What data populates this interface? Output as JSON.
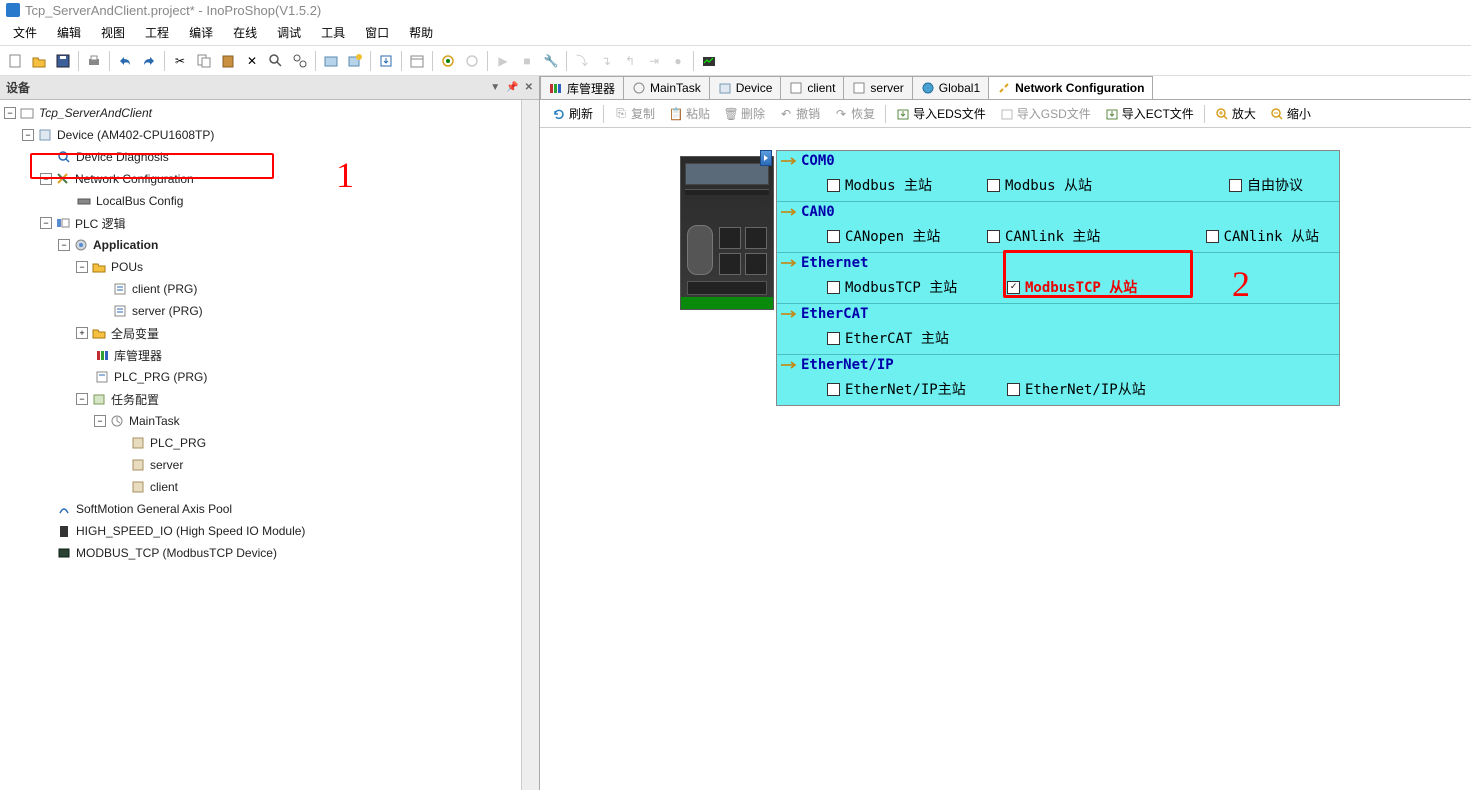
{
  "title": "Tcp_ServerAndClient.project* - InoProShop(V1.5.2)",
  "menus": [
    "文件",
    "编辑",
    "视图",
    "工程",
    "编译",
    "在线",
    "调试",
    "工具",
    "窗口",
    "帮助"
  ],
  "devicePanel": {
    "title": "设备",
    "ctrls": [
      "▼",
      "📌",
      "✕"
    ]
  },
  "tree": {
    "root": "Tcp_ServerAndClient",
    "device": "Device (AM402-CPU1608TP)",
    "diagnosis": "Device Diagnosis",
    "netcfg": "Network Configuration",
    "localbus": "LocalBus Config",
    "plcLogic": "PLC 逻辑",
    "application": "Application",
    "pous": "POUs",
    "client": "client (PRG)",
    "server": "server (PRG)",
    "globalVars": "全局变量",
    "libMgr": "库管理器",
    "plcPrg": "PLC_PRG (PRG)",
    "taskCfg": "任务配置",
    "mainTask": "MainTask",
    "taskPlcPrg": "PLC_PRG",
    "taskServer": "server",
    "taskClient": "client",
    "axisPool": "SoftMotion General Axis Pool",
    "highspeed": "HIGH_SPEED_IO (High Speed IO Module)",
    "modbusTcp": "MODBUS_TCP (ModbusTCP Device)"
  },
  "annotations": {
    "a1": "1",
    "a2": "2"
  },
  "tabs": [
    {
      "label": "库管理器"
    },
    {
      "label": "MainTask"
    },
    {
      "label": "Device"
    },
    {
      "label": "client"
    },
    {
      "label": "server"
    },
    {
      "label": "Global1"
    },
    {
      "label": "Network Configuration",
      "active": true
    }
  ],
  "subToolbar": {
    "refresh": "刷新",
    "copy": "复制",
    "paste": "粘贴",
    "delete": "删除",
    "undo": "撤销",
    "redo": "恢复",
    "importEDS": "导入EDS文件",
    "importGSD": "导入GSD文件",
    "importECT": "导入ECT文件",
    "zoomIn": "放大",
    "zoomOut": "缩小"
  },
  "config": {
    "com0": {
      "title": "COM0",
      "items": [
        "Modbus 主站",
        "Modbus 从站",
        "自由协议"
      ]
    },
    "can0": {
      "title": "CAN0",
      "items": [
        "CANopen 主站",
        "CANlink 主站",
        "CANlink 从站"
      ]
    },
    "ethernet": {
      "title": "Ethernet",
      "master": "ModbusTCP 主站",
      "slave": "ModbusTCP 从站"
    },
    "ethercat": {
      "title": "EtherCAT",
      "items": [
        "EtherCAT 主站"
      ]
    },
    "ethernetip": {
      "title": "EtherNet/IP",
      "items": [
        "EtherNet/IP主站",
        "EtherNet/IP从站"
      ]
    }
  }
}
